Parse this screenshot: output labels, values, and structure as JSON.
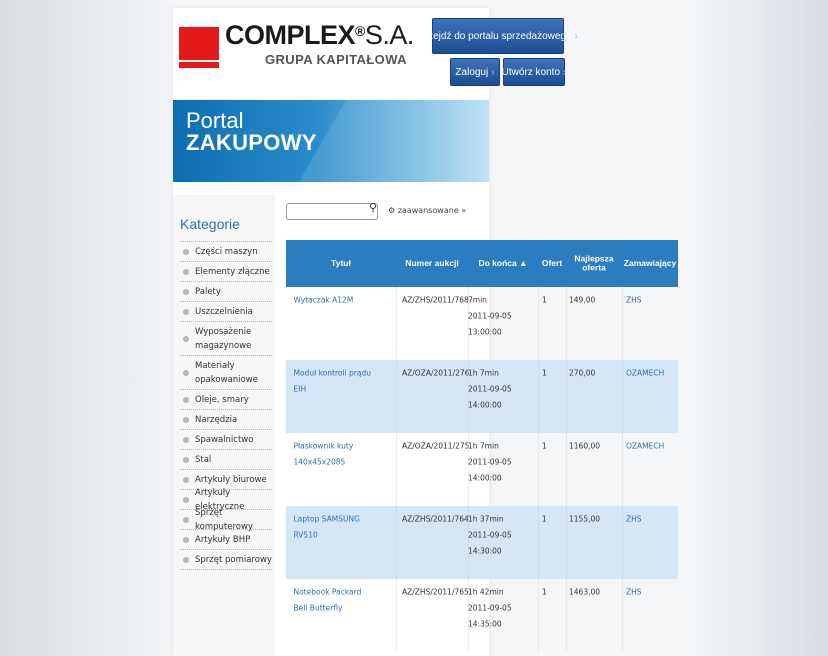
{
  "header": {
    "logo_main": "COMPLEX",
    "logo_reg": "®",
    "logo_sa": "S.A.",
    "logo_sub": "GRUPA KAPITAŁOWA",
    "portal_btn": "Przejdź do portalu sprzedażowego",
    "login_btn": "Zaloguj",
    "register_btn": "Utwórz konto"
  },
  "banner": {
    "line1": "Portal",
    "line2": "ZAKUPOWY"
  },
  "sidebar": {
    "heading": "Kategorie",
    "items": [
      "Części maszyn",
      "Elementy złączne",
      "Palety",
      "Uszczelnienia",
      "Wyposażenie magazynowe",
      "Materiały opakowaniowe",
      "Oleje, smary",
      "Narzędzia",
      "Spawalnictwo",
      "Stal",
      "Artykuły biurowe",
      "Artykuły elektryczne",
      "Sprzęt komputerowy",
      "Artykuły BHP",
      "Sprzęt pomiarowy"
    ]
  },
  "search": {
    "value": "",
    "advanced_label": "zaawansowane »"
  },
  "table": {
    "columns": [
      "Tytuł",
      "Numer aukcji",
      "Do końca ▲",
      "Ofert",
      "Najlepsza oferta",
      "Zamawiający"
    ],
    "rows": [
      {
        "title": "Wytaczak A12M",
        "number": "AZ/ZHS/2011/768",
        "time_left": "7min",
        "date": "2011-09-05",
        "hour": "13:00:00",
        "bids": "1",
        "best": "149,00",
        "customer": "ZHS"
      },
      {
        "title": "Moduł kontroli prądu EIH",
        "number": "AZ/OZA/2011/276",
        "time_left": "1h 7min",
        "date": "2011-09-05",
        "hour": "14:00:00",
        "bids": "1",
        "best": "270,00",
        "customer": "OZAMECH"
      },
      {
        "title": "Płaskownik kuty 140x45x2085",
        "number": "AZ/OZA/2011/275",
        "time_left": "1h 7min",
        "date": "2011-09-05",
        "hour": "14:00:00",
        "bids": "1",
        "best": "1160,00",
        "customer": "OZAMECH"
      },
      {
        "title": "Laptop SAMSUNG RV510",
        "number": "AZ/ZHS/2011/764",
        "time_left": "1h 37min",
        "date": "2011-09-05",
        "hour": "14:30:00",
        "bids": "1",
        "best": "1155,00",
        "customer": "ZHS"
      },
      {
        "title": "Notebook Packard Bell Butterfly",
        "number": "AZ/ZHS/2011/765",
        "time_left": "1h 42min",
        "date": "2011-09-05",
        "hour": "14:35:00",
        "bids": "1",
        "best": "1463,00",
        "customer": "ZHS"
      }
    ]
  }
}
